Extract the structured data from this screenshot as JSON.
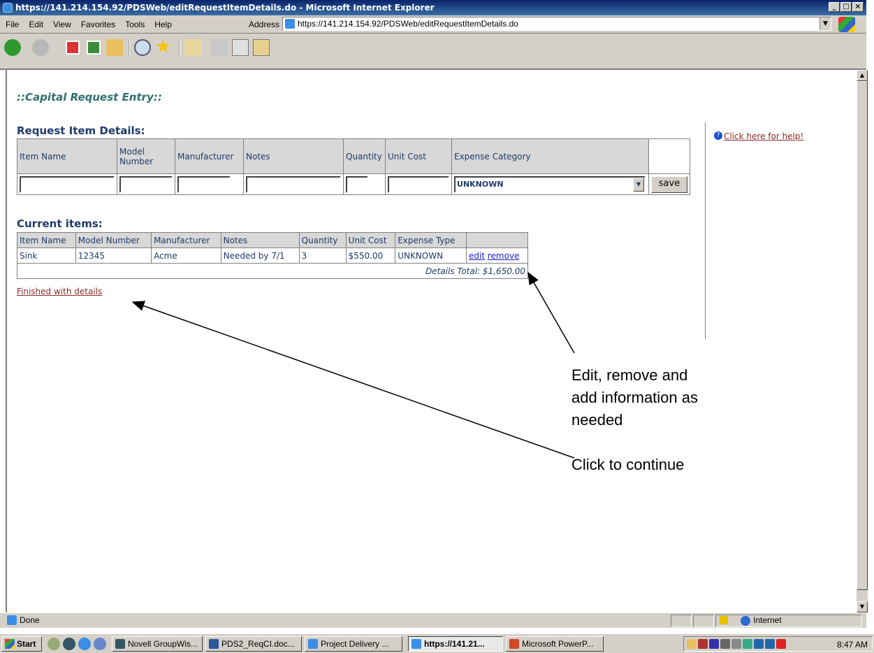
{
  "window": {
    "title": "https://141.214.154.92/PDSWeb/editRequestItemDetails.do - Microsoft Internet Explorer",
    "buttons": [
      "_",
      "□",
      "×"
    ]
  },
  "menu": {
    "items": [
      "File",
      "Edit",
      "View",
      "Favorites",
      "Tools",
      "Help"
    ],
    "address_label": "Address",
    "address_value": "https://141.214.154.92/PDSWeb/editRequestItemDetails.do"
  },
  "page": {
    "title": "::Capital Request Entry::",
    "request_section_title": "Request Item Details:",
    "request_headers": [
      "Item Name",
      "Model Number",
      "Manufacturer",
      "Notes",
      "Quantity",
      "Unit Cost",
      "Expense Category"
    ],
    "expense_category_selected": "UNKNOWN",
    "save_label": "save",
    "current_section_title": "Current items:",
    "current_headers": [
      "Item Name",
      "Model Number",
      "Manufacturer",
      "Notes",
      "Quantity",
      "Unit Cost",
      "Expense Type"
    ],
    "current_rows": [
      {
        "item_name": "Sink",
        "model_number": "12345",
        "manufacturer": "Acme",
        "notes": "Needed by 7/1",
        "quantity": "3",
        "unit_cost": "$550.00",
        "expense_type": "UNKNOWN",
        "edit": "edit",
        "remove": "remove"
      }
    ],
    "details_total": "Details Total: $1,650.00",
    "finished_link": "Finished with details",
    "help_link": "Click here for help!"
  },
  "annotations": {
    "edit_note_line1": "Edit, remove and",
    "edit_note_line2": "add information as",
    "edit_note_line3": "needed",
    "continue_note": "Click to continue"
  },
  "status": {
    "text": "Done",
    "zone": "Internet"
  },
  "taskbar": {
    "start": "Start",
    "tasks": [
      "Novell GroupWis...",
      "PDS2_ReqCI.doc...",
      "Project Delivery ...",
      "https://141.21...",
      "Microsoft PowerP..."
    ],
    "clock": "8:47 AM"
  }
}
